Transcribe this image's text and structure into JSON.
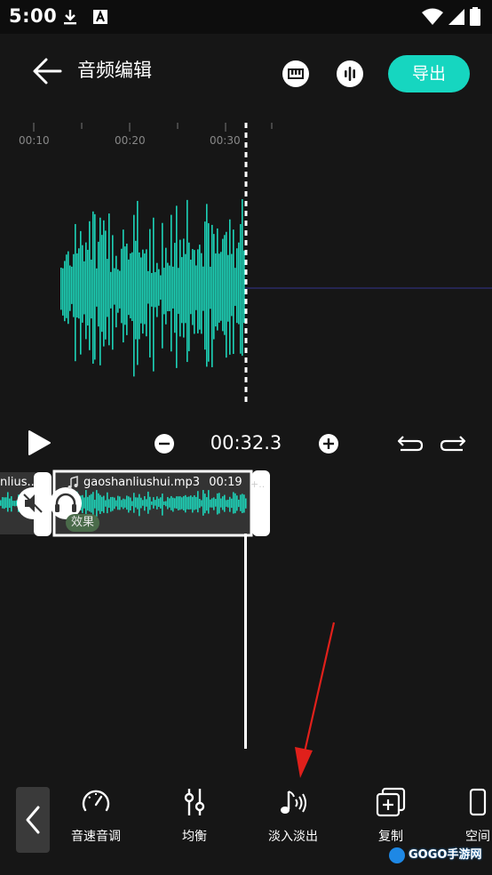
{
  "status_bar": {
    "time": "5:00",
    "icons": [
      "download-icon",
      "a-badge-icon",
      "wifi-icon",
      "signal-icon",
      "battery-icon"
    ]
  },
  "header": {
    "title": "音频编辑",
    "export_label": "导出",
    "icons": [
      "back-arrow-icon",
      "piano-icon",
      "waveform-icon"
    ]
  },
  "ruler": {
    "labels": [
      "00:10",
      "00:20",
      "00:30"
    ]
  },
  "transport": {
    "time": "00:32.3",
    "icons": [
      "play-icon",
      "zoom-out-icon",
      "zoom-in-icon",
      "undo-icon",
      "redo-icon"
    ]
  },
  "timeline": {
    "prev_clip_name": "nlius..",
    "clip_name": "gaoshanliushui.mp3",
    "clip_duration": "00:19",
    "effect_badge": "效果",
    "marker": "+..",
    "icons": [
      "music-note-icon",
      "mute-icon",
      "headphones-icon"
    ]
  },
  "toolbar": {
    "items": [
      {
        "label": "音速音调",
        "icon": "speedometer-icon"
      },
      {
        "label": "均衡",
        "icon": "equalizer-icon"
      },
      {
        "label": "淡入淡出",
        "icon": "fade-note-icon"
      },
      {
        "label": "复制",
        "icon": "copy-icon"
      },
      {
        "label": "空间",
        "icon": "space-icon"
      }
    ]
  },
  "watermark": "GOGO手游网",
  "colors": {
    "accent": "#16d6c0",
    "background": "#161616",
    "waveform": "#1dd3b8",
    "annotation_arrow": "#e0201b"
  }
}
